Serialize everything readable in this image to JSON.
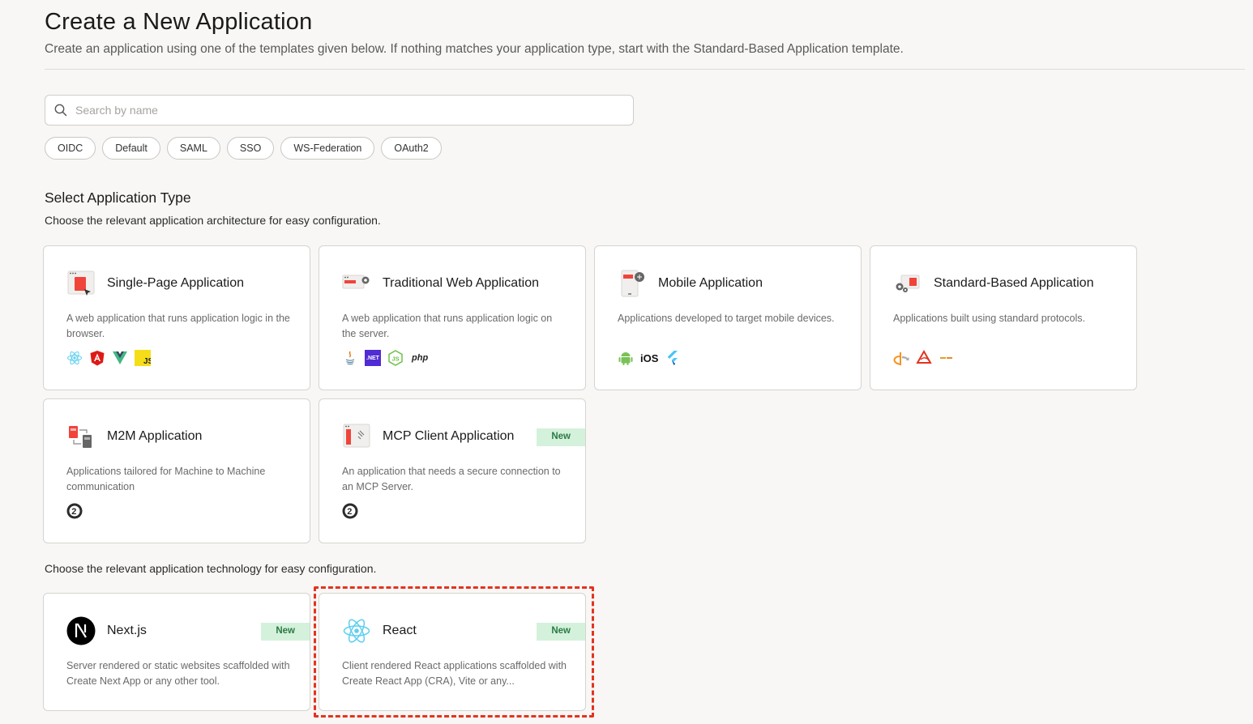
{
  "page": {
    "title": "Create a New Application",
    "subtitle": "Create an application using one of the templates given below. If nothing matches your application type, start with the Standard-Based Application template."
  },
  "search": {
    "placeholder": "Search by name",
    "value": ""
  },
  "filters": [
    "OIDC",
    "Default",
    "SAML",
    "SSO",
    "WS-Federation",
    "OAuth2"
  ],
  "app_types": {
    "title": "Select Application Type",
    "description": "Choose the relevant application architecture for easy configuration.",
    "cards": [
      {
        "title": "Single-Page Application",
        "description": "A web application that runs application logic in the browser.",
        "logos": [
          "react-logo",
          "angular-logo",
          "vue-logo",
          "javascript-logo"
        ]
      },
      {
        "title": "Traditional Web Application",
        "description": "A web application that runs application logic on the server.",
        "logos": [
          "java-logo",
          "dotnet-logo",
          "nodejs-logo",
          "php-logo"
        ],
        "logo_texts": {
          "dotnet": ".NET",
          "php": "php"
        }
      },
      {
        "title": "Mobile Application",
        "description": "Applications developed to target mobile devices.",
        "logos": [
          "android-logo",
          "ios-logo",
          "flutter-logo"
        ],
        "logo_texts": {
          "ios": "iOS"
        }
      },
      {
        "title": "Standard-Based Application",
        "description": "Applications built using standard protocols.",
        "logos": [
          "openid-logo",
          "saml-logo",
          "wsfed-logo"
        ]
      },
      {
        "title": "M2M Application",
        "description": "Applications tailored for Machine to Machine communication",
        "logos": [
          "oauth2-logo"
        ]
      },
      {
        "title": "MCP Client Application",
        "description": "An application that needs a secure connection to an MCP Server.",
        "badge": "New",
        "logos": [
          "oauth2-logo"
        ]
      }
    ]
  },
  "technologies": {
    "description": "Choose the relevant application technology for easy configuration.",
    "cards": [
      {
        "title": "Next.js",
        "description": "Server rendered or static websites scaffolded with Create Next App or any other tool.",
        "badge": "New"
      },
      {
        "title": "React",
        "description": "Client rendered React applications scaffolded with Create React App (CRA), Vite or any...",
        "badge": "New"
      }
    ]
  },
  "colors": {
    "accent": "#f26449",
    "badge_bg": "#d4f1dc",
    "badge_text": "#2c7a44",
    "highlight": "#e3331f"
  }
}
